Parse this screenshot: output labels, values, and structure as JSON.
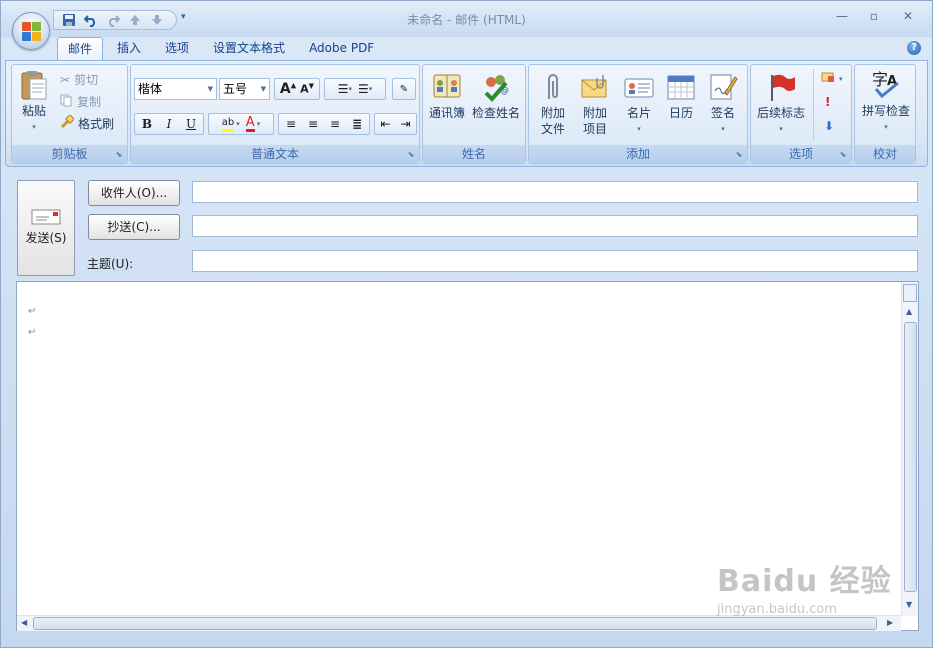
{
  "window": {
    "title": "未命名 - 邮件 (HTML)"
  },
  "quick_access": {
    "items": [
      "save-icon",
      "undo-icon",
      "redo-icon",
      "previous-item-icon",
      "next-item-icon"
    ],
    "more": "▾"
  },
  "tabs": [
    {
      "label": "邮件",
      "active": true
    },
    {
      "label": "插入",
      "active": false
    },
    {
      "label": "选项",
      "active": false
    },
    {
      "label": "设置文本格式",
      "active": false
    },
    {
      "label": "Adobe PDF",
      "active": false
    }
  ],
  "ribbon": {
    "clipboard": {
      "label": "剪贴板",
      "paste": "粘贴",
      "cut": "剪切",
      "copy": "复制",
      "format_painter": "格式刷"
    },
    "basic_text": {
      "label": "普通文本",
      "font_name": "楷体",
      "font_size": "五号",
      "grow_font": "A",
      "shrink_font": "A",
      "bold": "B",
      "italic": "I",
      "underline": "U",
      "highlight": "ab",
      "font_color": "A"
    },
    "names": {
      "label": "姓名",
      "address_book": "通讯簿",
      "check_names": "检查姓名"
    },
    "include": {
      "label": "添加",
      "attach_file_1": "附加",
      "attach_file_2": "文件",
      "attach_item_1": "附加",
      "attach_item_2": "项目",
      "business_card": "名片",
      "calendar": "日历",
      "signature": "签名"
    },
    "options": {
      "label": "选项",
      "follow_up": "后续标志"
    },
    "proofing": {
      "label": "校对",
      "spelling": "拼写检查"
    }
  },
  "compose": {
    "send": "发送(S)",
    "to_button": "收件人(O)...",
    "cc_button": "抄送(C)...",
    "subject_label": "主题(U):",
    "to_value": "",
    "cc_value": "",
    "subject_value": ""
  },
  "body": {
    "para_marks": [
      "↵",
      "↵"
    ]
  },
  "watermark": {
    "brand": "Baidu 经验",
    "url": "jingyan.baidu.com"
  },
  "colors": {
    "accent": "#15428b",
    "ribbon_border": "#8db2e3",
    "highlight": "#ffff00",
    "font_color": "#e02020"
  }
}
